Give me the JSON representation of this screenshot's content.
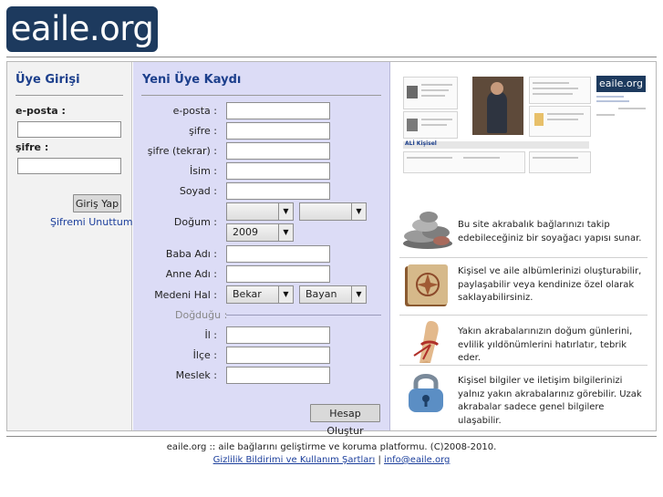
{
  "logo": {
    "text": "eaile.org"
  },
  "login": {
    "title": "Üye Girişi",
    "email_label": "e-posta :",
    "password_label": "şifre :",
    "submit": "Giriş Yap",
    "forgot": "Şifremi Unuttum >"
  },
  "register": {
    "title": "Yeni Üye Kaydı",
    "email_label": "e-posta :",
    "password_label": "şifre :",
    "password2_label": "şifre (tekrar) :",
    "name_label": "İsim :",
    "surname_label": "Soyad :",
    "birth_label": "Doğum :",
    "birth_year": "2009",
    "father_label": "Baba Adı :",
    "mother_label": "Anne Adı :",
    "marital_label": "Medeni Hal :",
    "marital_value": "Bekar",
    "gender_value": "Bayan",
    "birthplace_label": "Doğduğu :",
    "province_label": "İl :",
    "district_label": "İlçe :",
    "job_label": "Meslek :",
    "submit": "Hesap Oluştur"
  },
  "preview": {
    "logo": "eaile.org",
    "tab_label": "ALİ Kişisel"
  },
  "features": [
    {
      "icon": "stones-icon",
      "text": "Bu site akrabalık bağlarınızı takip edebileceğiniz bir soyağacı yapısı sunar."
    },
    {
      "icon": "album-icon",
      "text": "Kişisel ve aile albümlerinizi oluşturabilir, paylaşabilir veya kendinize özel olarak saklayabilirsiniz."
    },
    {
      "icon": "string-finger-icon",
      "text": "Yakın akrabalarınızın doğum günlerini, evlilik yıldönümlerini hatırlatır, tebrik eder."
    },
    {
      "icon": "padlock-icon",
      "text": "Kişisel bilgiler ve iletişim bilgilerinizi yalnız yakın akrabalarınız görebilir. Uzak akrabalar sadece genel bilgilere ulaşabilir."
    }
  ],
  "footer": {
    "line1": "eaile.org :: aile bağlarını geliştirme ve koruma platformu. (C)2008-2010.",
    "privacy": "Gizlilik Bildirimi ve Kullanım Şartları",
    "separator": "|",
    "email": "info@eaile.org"
  },
  "colors": {
    "brand": "#1d3a5e",
    "title": "#1c3f8c",
    "register_bg": "#dcdcf6",
    "login_bg": "#f2f2f2"
  }
}
